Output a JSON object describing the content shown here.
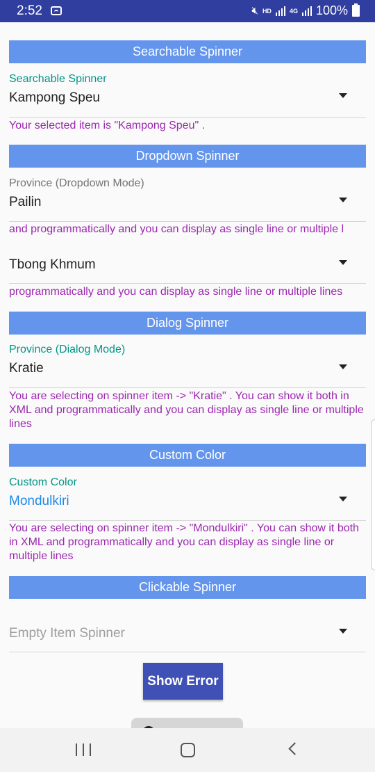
{
  "status_bar": {
    "time": "2:52",
    "hd": "HD",
    "network": "4G",
    "battery": "100%"
  },
  "searchable": {
    "header": "Searchable Spinner",
    "label": "Searchable Spinner",
    "value": "Kampong Speu",
    "message": "Your selected item is \"Kampong Speu\" ."
  },
  "dropdown": {
    "header": "Dropdown Spinner",
    "label": "Province (Dropdown Mode)",
    "value": "Pailin",
    "message": "and programmatically and you can display as single line or multiple l",
    "value2": "Tbong Khmum",
    "message2": " programmatically and you can display as single line or multiple lines"
  },
  "dialog": {
    "header": "Dialog Spinner",
    "label": "Province (Dialog Mode)",
    "value": "Kratie",
    "message": "You are selecting on spinner item -> \"Kratie\" . You can show it both in XML and programmatically and you can display as single line or multiple lines"
  },
  "custom": {
    "header": "Custom Color",
    "label": "Custom Color",
    "value": "Mondulkiri",
    "message": "You are selecting on spinner item -> \"Mondulkiri\" . You can show it both in XML and programmatically and you can display as single line or multiple lines"
  },
  "clickable": {
    "header": "Clickable Spinner",
    "placeholder": "Empty Item Spinner",
    "button": "Show Error"
  },
  "colors": {
    "status_bar": "#303f9f",
    "header": "#6495ed",
    "label_accent": "#009688",
    "message": "#9c27b0",
    "custom_value": "#1e88e5",
    "button": "#3f51b5"
  },
  "icons": {
    "spinner_arrow": "dropdown-arrow-icon",
    "nav": [
      "recent-apps-icon",
      "home-icon",
      "back-icon"
    ]
  }
}
